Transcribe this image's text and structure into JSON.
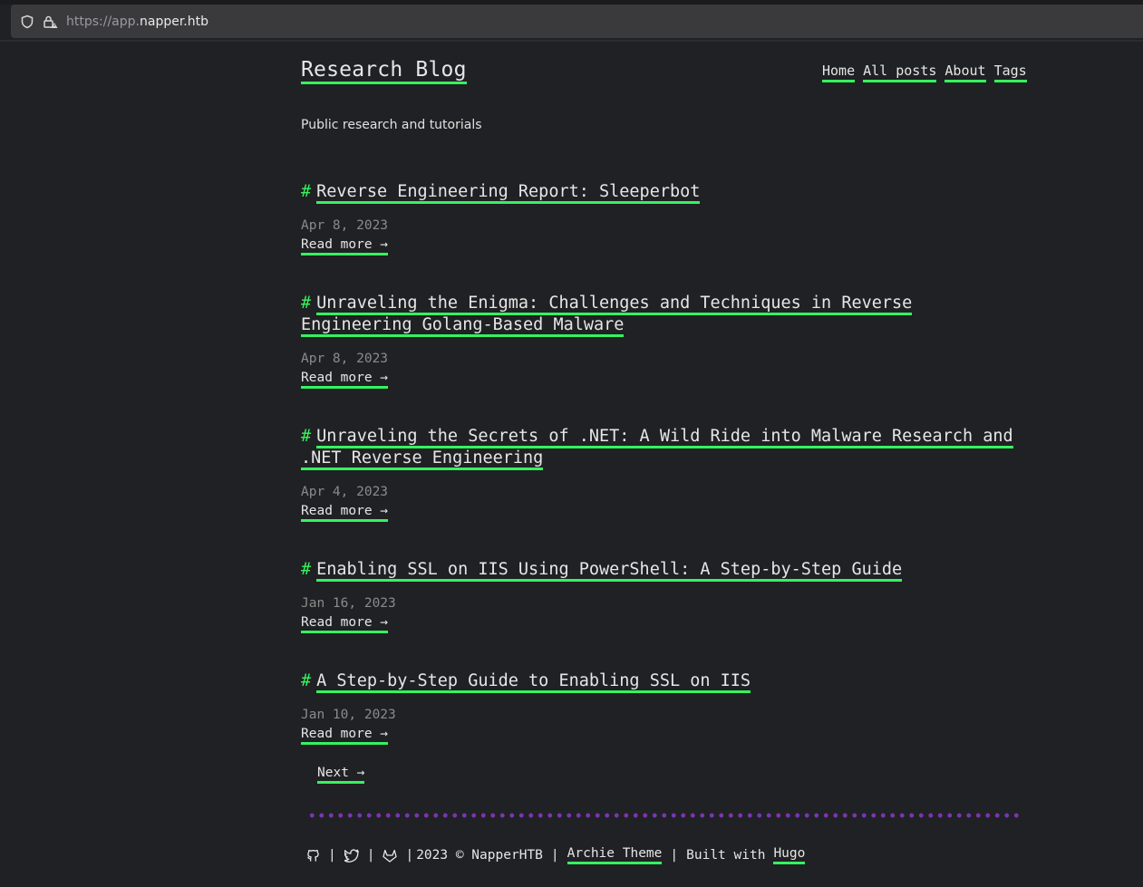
{
  "browser": {
    "url_prefix": "https://app.",
    "url_host": "napper.htb"
  },
  "site": {
    "title": "Research Blog",
    "tagline": "Public research and tutorials",
    "nav": [
      "Home",
      "All posts",
      "About",
      "Tags"
    ]
  },
  "posts": [
    {
      "hash": "#",
      "title": "Reverse Engineering Report: Sleeperbot",
      "date": "Apr 8, 2023",
      "read_more": "Read more →"
    },
    {
      "hash": "#",
      "title": "Unraveling the Enigma: Challenges and Techniques in Reverse Engineering Golang-Based Malware",
      "date": "Apr 8, 2023",
      "read_more": "Read more →"
    },
    {
      "hash": "#",
      "title": "Unraveling the Secrets of .NET: A Wild Ride into Malware Research and .NET Reverse Engineering",
      "date": "Apr 4, 2023",
      "read_more": "Read more →"
    },
    {
      "hash": "#",
      "title": "Enabling SSL on IIS Using PowerShell: A Step-by-Step Guide",
      "date": "Jan 16, 2023",
      "read_more": "Read more →"
    },
    {
      "hash": "#",
      "title": "A Step-by-Step Guide to Enabling SSL on IIS",
      "date": "Jan 10, 2023",
      "read_more": "Read more →"
    }
  ],
  "pager": {
    "next": "Next →"
  },
  "footer": {
    "bar": "|",
    "copyright": "2023 © NapperHTB",
    "sep": "|",
    "theme_link": "Archie Theme",
    "built_with": "Built with",
    "hugo_link": "Hugo"
  },
  "icons": {
    "shield": "shield-icon",
    "lock": "lock-warning-icon",
    "github": "github-icon",
    "twitter": "twitter-icon",
    "gitlab": "gitlab-icon"
  },
  "colors": {
    "background": "#202124",
    "accent": "#35f35e",
    "divider_dots": "#7a35b0",
    "date": "#8b8b8b"
  }
}
